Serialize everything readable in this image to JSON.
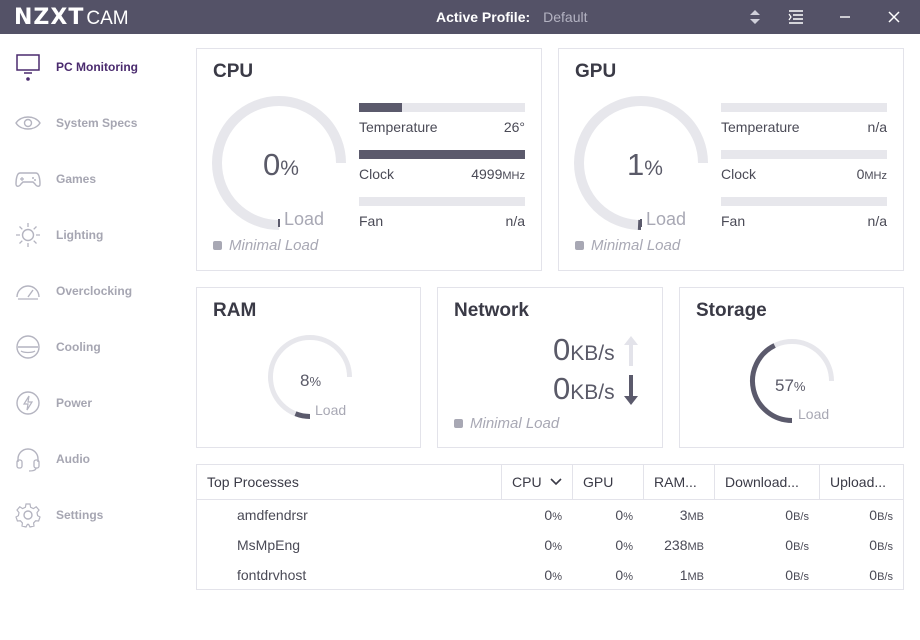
{
  "titlebar": {
    "logo_bold": "NZXT",
    "logo_light": "CAM",
    "profile_label": "Active Profile:",
    "profile_value": "Default",
    "icons": [
      "profile-switch-icon",
      "menu-icon",
      "minimize-icon",
      "close-icon"
    ]
  },
  "sidebar": {
    "items": [
      {
        "label": "PC Monitoring",
        "icon": "monitor-icon",
        "active": true
      },
      {
        "label": "System Specs",
        "icon": "eye-icon",
        "active": false
      },
      {
        "label": "Games",
        "icon": "gamepad-icon",
        "active": false
      },
      {
        "label": "Lighting",
        "icon": "sun-icon",
        "active": false
      },
      {
        "label": "Overclocking",
        "icon": "speedometer-icon",
        "active": false
      },
      {
        "label": "Cooling",
        "icon": "cooling-icon",
        "active": false
      },
      {
        "label": "Power",
        "icon": "power-bolt-icon",
        "active": false
      },
      {
        "label": "Audio",
        "icon": "headphones-icon",
        "active": false
      },
      {
        "label": "Settings",
        "icon": "gear-icon",
        "active": false
      }
    ]
  },
  "cpu": {
    "title": "CPU",
    "load_value": "0",
    "load_unit": "%",
    "load_label": "Load",
    "load_fraction": 0.0,
    "legend": "Minimal Load",
    "temperature": {
      "label": "Temperature",
      "value": "26°",
      "fraction": 0.26
    },
    "clock": {
      "label": "Clock",
      "value": "4999",
      "unit": "MHz",
      "fraction": 1.0
    },
    "fan": {
      "label": "Fan",
      "value": "n/a",
      "fraction": 0.0
    }
  },
  "gpu": {
    "title": "GPU",
    "load_value": "1",
    "load_unit": "%",
    "load_label": "Load",
    "load_fraction": 0.01,
    "legend": "Minimal Load",
    "temperature": {
      "label": "Temperature",
      "value": "n/a",
      "fraction": 0.0
    },
    "clock": {
      "label": "Clock",
      "value": "0",
      "unit": "MHz",
      "fraction": 0.0
    },
    "fan": {
      "label": "Fan",
      "value": "n/a",
      "fraction": 0.0
    }
  },
  "ram": {
    "title": "RAM",
    "value": "8",
    "unit": "%",
    "load_label": "Load",
    "fraction": 0.08
  },
  "network": {
    "title": "Network",
    "upload_value": "0",
    "upload_unit": "KB/s",
    "download_value": "0",
    "download_unit": "KB/s",
    "legend": "Minimal Load"
  },
  "storage": {
    "title": "Storage",
    "value": "57",
    "unit": "%",
    "load_label": "Load",
    "fraction": 0.57
  },
  "processes": {
    "headers": [
      "Top Processes",
      "CPU",
      "GPU",
      "RAM...",
      "Download...",
      "Upload..."
    ],
    "rows": [
      {
        "name": "amdfendrsr",
        "cpu": "0",
        "gpu": "0",
        "ram": "3",
        "ram_unit": "MB",
        "download": "0",
        "upload": "0"
      },
      {
        "name": "MsMpEng",
        "cpu": "0",
        "gpu": "0",
        "ram": "238",
        "ram_unit": "MB",
        "download": "0",
        "upload": "0"
      },
      {
        "name": "fontdrvhost",
        "cpu": "0",
        "gpu": "0",
        "ram": "1",
        "ram_unit": "MB",
        "download": "0",
        "upload": "0"
      }
    ],
    "pct_unit": "%",
    "rate_unit": "B/s"
  },
  "colors": {
    "titlebar": "#545267",
    "accent_purple": "#4a2a6e",
    "gauge_track": "#e7e7ec",
    "gauge_fill": "#5b5a6c",
    "arrow_up": "#e3e3ea",
    "arrow_down": "#5b5a6c"
  }
}
